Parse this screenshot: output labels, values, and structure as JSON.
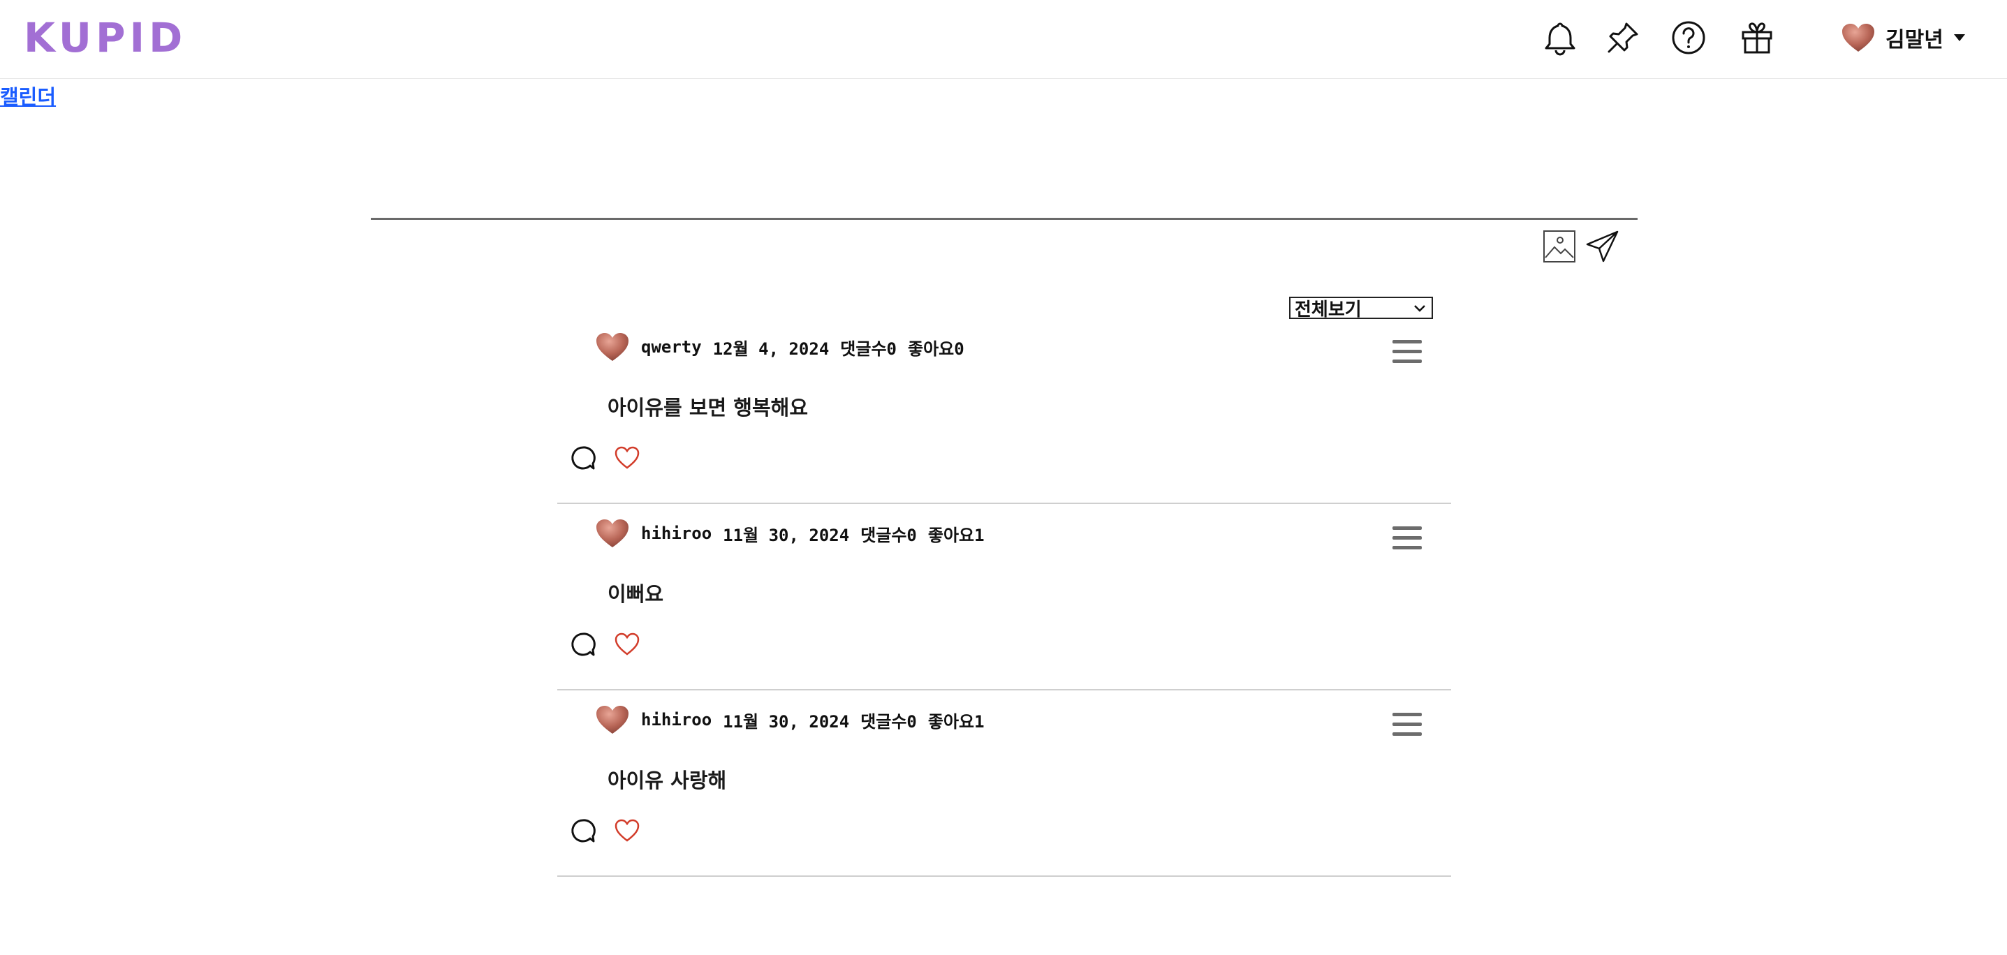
{
  "header": {
    "logo": "KUPID",
    "icons": [
      "bell-icon",
      "pin-icon",
      "help-icon",
      "gift-icon"
    ],
    "user_name": "김말년"
  },
  "nav": {
    "calendar_link": "캘린더"
  },
  "compose": {
    "tools": [
      "image-icon",
      "send-icon"
    ]
  },
  "filter": {
    "selected": "전체보기"
  },
  "colors": {
    "logo": "#a26fd4",
    "like": "#d23c2a",
    "link": "#1a5cff"
  },
  "posts": [
    {
      "author": "qwerty",
      "date": "12월 4, 2024",
      "comments": "댓글수0",
      "likes": "좋아요0",
      "content": "아이유를 보면 행복해요"
    },
    {
      "author": "hihiroo",
      "date": "11월 30, 2024",
      "comments": "댓글수0",
      "likes": "좋아요1",
      "content": "이뻐요"
    },
    {
      "author": "hihiroo",
      "date": "11월 30, 2024",
      "comments": "댓글수0",
      "likes": "좋아요1",
      "content": "아이유 사랑해"
    }
  ]
}
